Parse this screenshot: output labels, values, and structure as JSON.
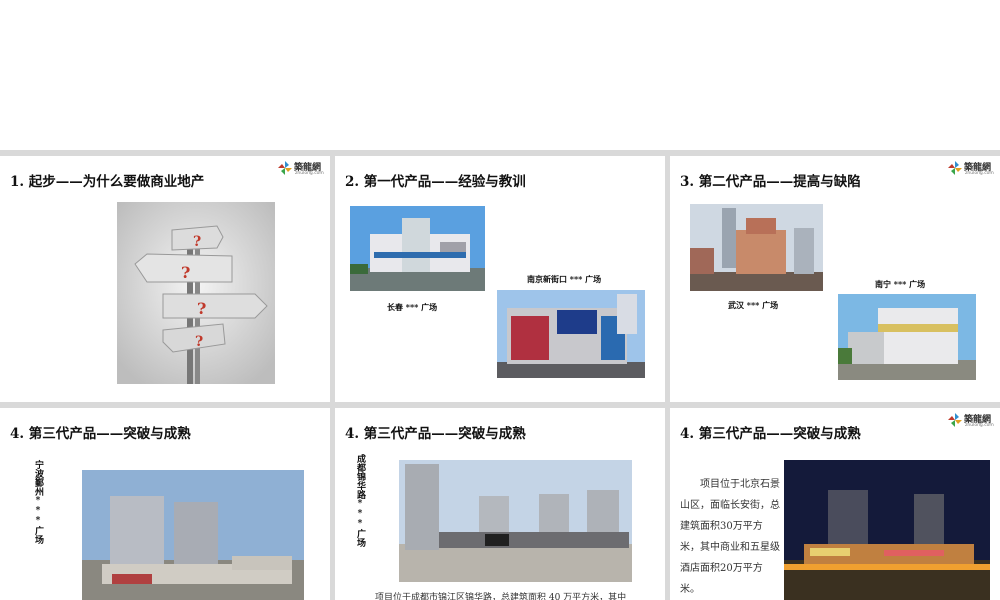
{
  "logo": {
    "cn": "築龍網",
    "en": "zhulong.com"
  },
  "slides": [
    {
      "title": "1.  起步——为什么要做商业地产"
    },
    {
      "title": "2.  第一代产品——经验与教训",
      "captions": [
        "长春 *** 广场",
        "南京新街口 *** 广场"
      ]
    },
    {
      "title": "3.  第二代产品——提高与缺陷",
      "captions": [
        "武汉 *** 广场",
        "南宁 *** 广场"
      ]
    },
    {
      "title": "4.   第三代产品——突破与成熟",
      "vertical_caption": "宁波鄞州***广场"
    },
    {
      "title": "4.  第三代产品——突破与成熟",
      "vertical_caption": "成都锦华路***广场",
      "footer": "项目位于成都市锦江区锦华路，总建筑面积 40 万平方米，其中"
    },
    {
      "title": "4.  第三代产品——突破与成熟",
      "paragraph": "项目位于北京石景山区，面临长安街，总建筑面积30万平方米，其中商业和五星级酒店面积20万平方米。"
    }
  ],
  "photos": {
    "signpost": "signpost-question-marks",
    "changchun": "changchun-plaza",
    "nanjing": "nanjing-xinjiekou-plaza",
    "wuhan": "wuhan-plaza",
    "nanning": "nanning-plaza",
    "ningbo": "ningbo-yinzhou-plaza",
    "chengdu": "chengdu-jinhua-plaza",
    "beijing": "beijing-shijingshan-night"
  }
}
